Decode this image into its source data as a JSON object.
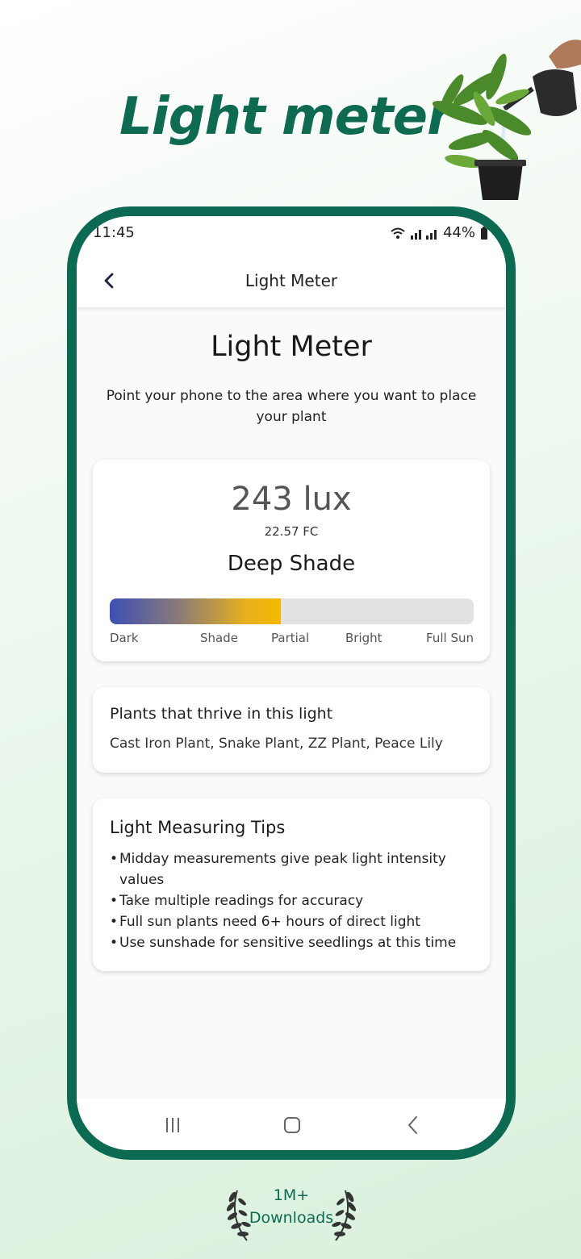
{
  "promo": {
    "headline": "Light meter",
    "badge_line1": "1M+",
    "badge_line2": "Downloads"
  },
  "status_bar": {
    "time": "11:45",
    "battery": "44%"
  },
  "app_bar": {
    "title": "Light Meter"
  },
  "page": {
    "title": "Light Meter",
    "subtitle": "Point your phone to the area where you want to place your plant"
  },
  "meter": {
    "lux": "243 lux",
    "foot_candles": "22.57 FC",
    "category": "Deep Shade",
    "level_fraction": 0.47,
    "scale_labels": [
      "Dark",
      "Shade",
      "Partial",
      "Bright",
      "Full Sun"
    ]
  },
  "plants": {
    "heading": "Plants that thrive in this light",
    "list": "Cast Iron Plant, Snake Plant, ZZ Plant, Peace Lily"
  },
  "tips": {
    "heading": "Light Measuring Tips",
    "items": [
      "Midday measurements give peak light intensity values",
      "Take multiple readings for accuracy",
      "Full sun plants need 6+ hours of direct light",
      "Use sunshade for sensitive seedlings at this time"
    ]
  },
  "colors": {
    "brand_green": "#0d6a52",
    "meter_start": "#3d4fb5",
    "meter_end": "#f5b800"
  },
  "icons": {
    "back": "chevron-left-icon",
    "wifi": "wifi-icon",
    "signal": "signal-icon",
    "battery": "battery-icon",
    "recents": "recents-icon",
    "home": "home-icon",
    "nav_back": "back-icon"
  }
}
